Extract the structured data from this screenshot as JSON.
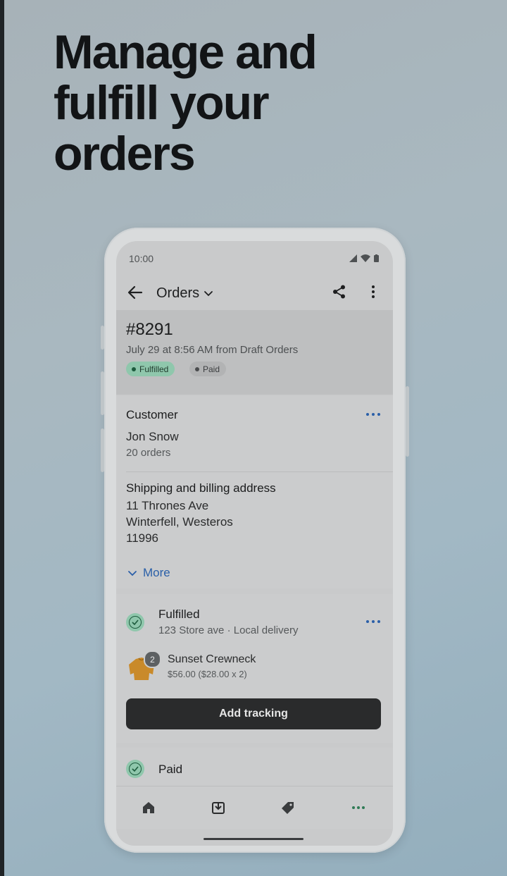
{
  "headline": [
    "Manage and",
    "fulfill your",
    "orders"
  ],
  "status_bar": {
    "time": "10:00"
  },
  "app_bar": {
    "title": "Orders"
  },
  "order": {
    "number": "#8291",
    "meta": "July 29 at 8:56 AM from Draft Orders",
    "badges": {
      "fulfilled": "Fulfilled",
      "paid": "Paid"
    }
  },
  "customer": {
    "heading": "Customer",
    "name": "Jon Snow",
    "orders": "20 orders"
  },
  "address": {
    "heading": "Shipping and billing address",
    "line1": "11 Thrones Ave",
    "line2": "Winterfell, Westeros",
    "line3": "11996",
    "more_label": "More"
  },
  "fulfillment": {
    "status": "Fulfilled",
    "location": "123 Store ave · Local delivery",
    "item_name": "Sunset Crewneck",
    "item_price": "$56.00 ($28.00 x 2)",
    "quantity": "2",
    "action_label": "Add tracking"
  },
  "payment": {
    "status": "Paid"
  },
  "colors": {
    "accent_link": "#2a5fa8",
    "success_badge": "#8fc7ac",
    "button_dark": "#2a2b2c"
  },
  "icons": {
    "back": "arrow-left-icon",
    "dropdown": "chevron-down-icon",
    "share": "share-icon",
    "overflow": "more-vertical-icon",
    "tabs": [
      "home-icon",
      "orders-icon",
      "tag-icon",
      "more-horizontal-icon"
    ]
  }
}
